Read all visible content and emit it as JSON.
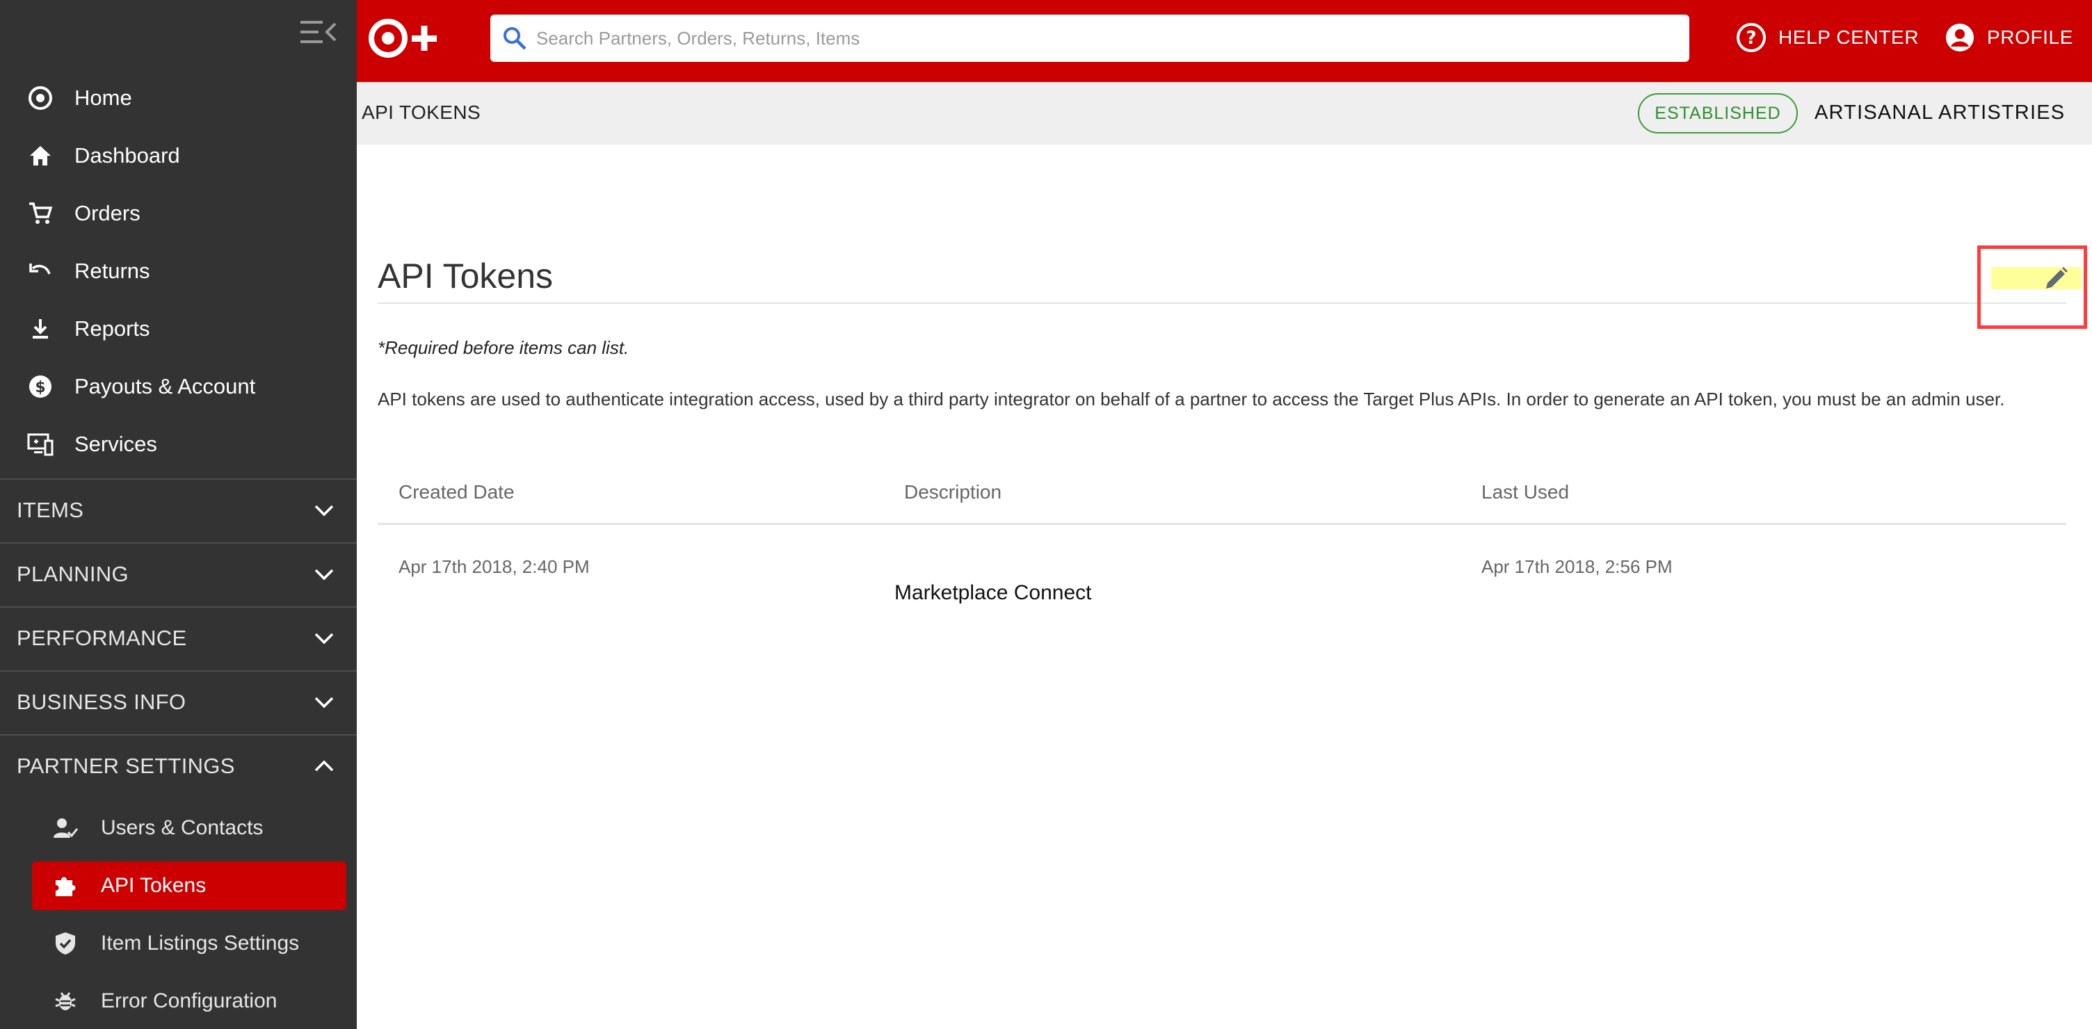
{
  "sidebar": {
    "nav": [
      {
        "label": "Home",
        "icon": "target-icon"
      },
      {
        "label": "Dashboard",
        "icon": "home-icon"
      },
      {
        "label": "Orders",
        "icon": "cart-icon"
      },
      {
        "label": "Returns",
        "icon": "undo-icon"
      },
      {
        "label": "Reports",
        "icon": "download-icon"
      },
      {
        "label": "Payouts & Account",
        "icon": "dollar-icon"
      },
      {
        "label": "Services",
        "icon": "services-icon"
      }
    ],
    "sections": [
      {
        "label": "ITEMS",
        "expanded": false
      },
      {
        "label": "PLANNING",
        "expanded": false
      },
      {
        "label": "PERFORMANCE",
        "expanded": false
      },
      {
        "label": "BUSINESS INFO",
        "expanded": false
      },
      {
        "label": "PARTNER SETTINGS",
        "expanded": true
      }
    ],
    "partner_settings_items": [
      {
        "label": "Users & Contacts",
        "icon": "user-check-icon",
        "active": false
      },
      {
        "label": "API Tokens",
        "icon": "puzzle-icon",
        "active": true
      },
      {
        "label": "Item Listings Settings",
        "icon": "shield-check-icon",
        "active": false
      },
      {
        "label": "Error Configuration",
        "icon": "bug-icon",
        "active": false
      }
    ]
  },
  "topbar": {
    "search_placeholder": "Search Partners, Orders, Returns, Items",
    "help_label": "HELP CENTER",
    "profile_label": "PROFILE"
  },
  "subheader": {
    "crumb": "API TOKENS",
    "status": "ESTABLISHED",
    "partner": "ARTISANAL ARTISTRIES"
  },
  "main": {
    "title": "API Tokens",
    "required_note": "*Required before items can list.",
    "description": "API tokens are used to authenticate integration access, used by a third party integrator on behalf of a partner to access the Target Plus APIs. In order to generate an API token, you must be an admin user.",
    "table": {
      "headers": [
        "Created Date",
        "Description",
        "Last Used"
      ],
      "rows": [
        {
          "created": "Apr 17th 2018, 2:40 PM",
          "description": "Marketplace Connect",
          "last_used": "Apr 17th 2018, 2:56 PM"
        }
      ]
    }
  },
  "colors": {
    "brand": "#cc0000",
    "sidebar": "#333333",
    "established": "#3a9b3a"
  }
}
